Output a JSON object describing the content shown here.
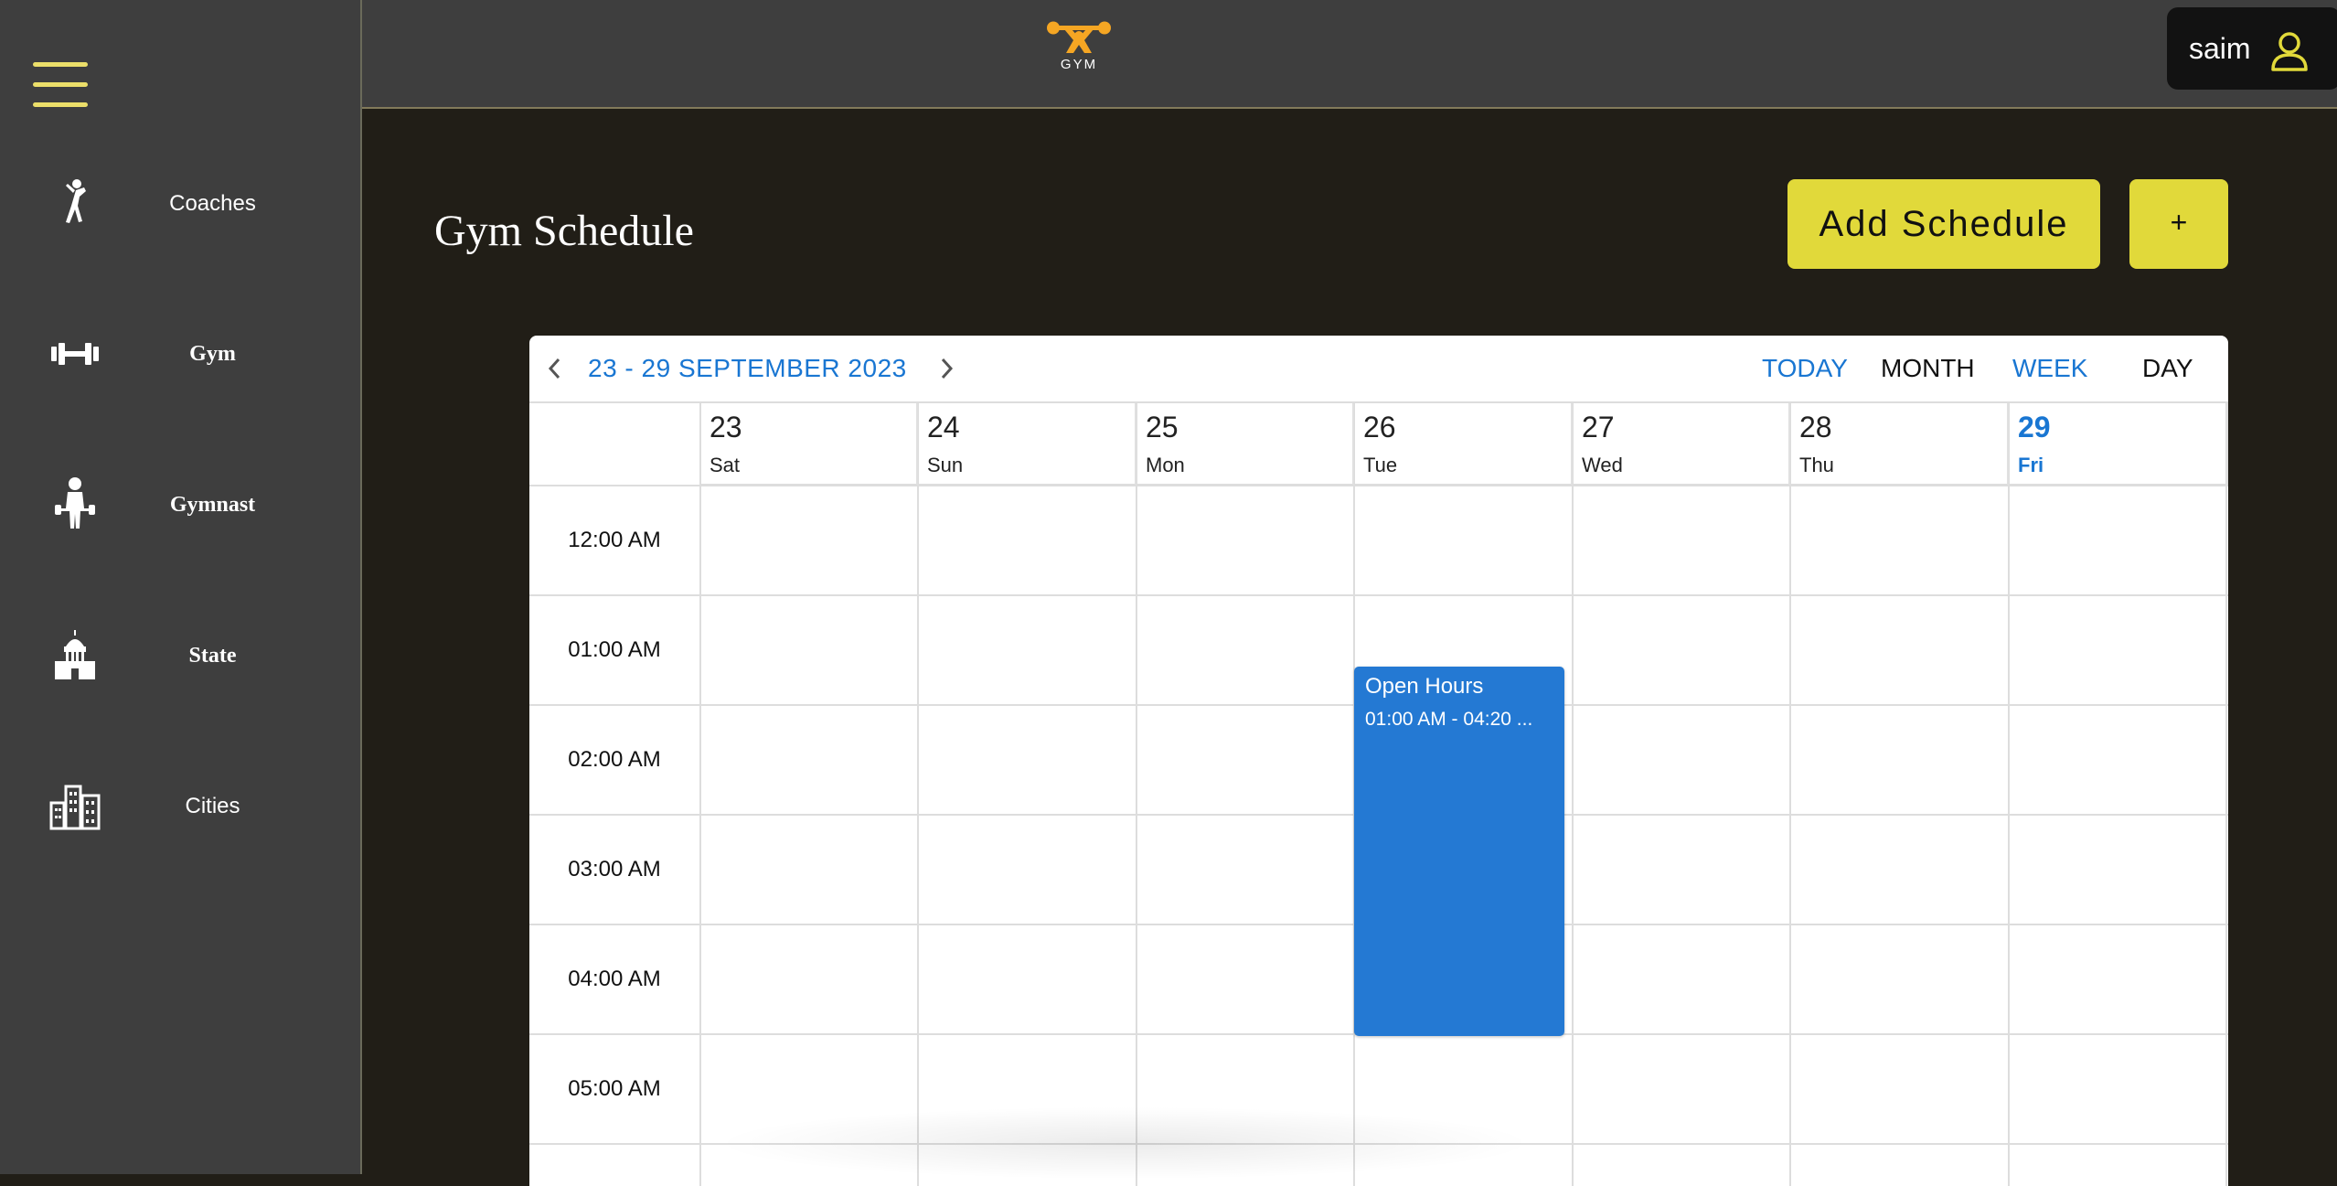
{
  "sidebar": {
    "items": [
      {
        "label": "Coaches",
        "icon": "coach-icon"
      },
      {
        "label": "Gym",
        "icon": "dumbbell-icon"
      },
      {
        "label": "Gymnast",
        "icon": "gymnast-icon"
      },
      {
        "label": "State",
        "icon": "capitol-icon"
      },
      {
        "label": "Cities",
        "icon": "city-buildings-icon"
      }
    ]
  },
  "header": {
    "logo_text": "GYM",
    "username": "saim"
  },
  "page": {
    "title": "Gym Schedule",
    "add_schedule_label": "Add Schedule",
    "plus_label": "+"
  },
  "calendar": {
    "range_label": "23 - 29 SEPTEMBER 2023",
    "views": {
      "today": "TODAY",
      "month": "MONTH",
      "week": "WEEK",
      "day": "DAY"
    },
    "days": [
      {
        "num": "23",
        "name": "Sat"
      },
      {
        "num": "24",
        "name": "Sun"
      },
      {
        "num": "25",
        "name": "Mon"
      },
      {
        "num": "26",
        "name": "Tue"
      },
      {
        "num": "27",
        "name": "Wed"
      },
      {
        "num": "28",
        "name": "Thu"
      },
      {
        "num": "29",
        "name": "Fri"
      }
    ],
    "times": [
      "12:00 AM",
      "01:00 AM",
      "02:00 AM",
      "03:00 AM",
      "04:00 AM",
      "05:00 AM"
    ],
    "event": {
      "title": "Open Hours",
      "time": "01:00 AM - 04:20 ..."
    }
  },
  "colors": {
    "accent_yellow": "#e1d93a",
    "calendar_blue": "#1976d2",
    "event_blue": "#2479d3",
    "sidebar_bg": "#3e3e3e",
    "page_bg": "#211e17"
  }
}
